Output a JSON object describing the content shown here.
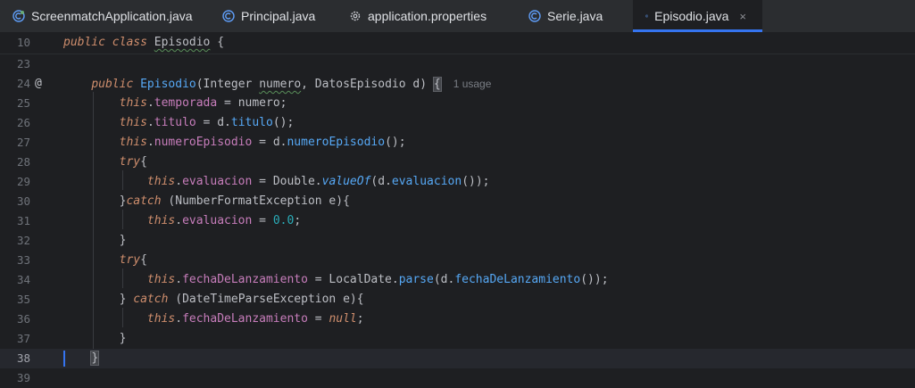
{
  "tabs": [
    {
      "label": "ScreenmatchApplication.java",
      "icon": "spring-class-icon",
      "active": false
    },
    {
      "label": "Principal.java",
      "icon": "class-icon",
      "active": false
    },
    {
      "label": "application.properties",
      "icon": "gear-icon",
      "active": false
    },
    {
      "label": "Serie.java",
      "icon": "class-icon",
      "active": false
    },
    {
      "label": "Episodio.java",
      "icon": "class-icon",
      "active": true
    }
  ],
  "close_glyph": "×",
  "lines": [
    {
      "n": "10"
    },
    {
      "n": "23"
    },
    {
      "n": "24"
    },
    {
      "n": "25"
    },
    {
      "n": "26"
    },
    {
      "n": "27"
    },
    {
      "n": "28"
    },
    {
      "n": "29"
    },
    {
      "n": "30"
    },
    {
      "n": "31"
    },
    {
      "n": "32"
    },
    {
      "n": "33"
    },
    {
      "n": "34"
    },
    {
      "n": "35"
    },
    {
      "n": "36"
    },
    {
      "n": "37"
    },
    {
      "n": "38"
    },
    {
      "n": "39"
    }
  ],
  "code": {
    "l10": {
      "kw1": "public",
      "kw2": "class",
      "name": "Episodio",
      "rest": " {"
    },
    "l24": {
      "kw": "public",
      "name": "Episodio",
      "p1": "(Integer ",
      "p2": "numero",
      "p3": ", DatosEpisodio d) ",
      "brace": "{",
      "hint": "1 usage"
    },
    "l25": {
      "this": "this",
      "field": "temporada",
      "rest": " = numero;"
    },
    "l26": {
      "this": "this",
      "field": "titulo",
      "mid": " = d.",
      "meth": "titulo",
      "rest": "();"
    },
    "l27": {
      "this": "this",
      "field": "numeroEpisodio",
      "mid": " = d.",
      "meth": "numeroEpisodio",
      "rest": "();"
    },
    "l28": {
      "kw": "try",
      "rest": "{"
    },
    "l29": {
      "this": "this",
      "field": "evaluacion",
      "mid": " = Double.",
      "meth": "valueOf",
      "mid2": "(d.",
      "meth2": "evaluacion",
      "rest": "());"
    },
    "l30": {
      "pre": "}",
      "kw": "catch",
      "rest": " (NumberFormatException e){"
    },
    "l31": {
      "this": "this",
      "field": "evaluacion",
      "mid": " = ",
      "num": "0.0",
      "rest": ";"
    },
    "l32": {
      "rest": "}"
    },
    "l33": {
      "kw": "try",
      "rest": "{"
    },
    "l34": {
      "this": "this",
      "field": "fechaDeLanzamiento",
      "mid": " = LocalDate.",
      "meth": "parse",
      "mid2": "(d.",
      "meth2": "fechaDeLanzamiento",
      "rest": "());"
    },
    "l35": {
      "pre": "} ",
      "kw": "catch",
      "rest": " (DateTimeParseException e){"
    },
    "l36": {
      "this": "this",
      "field": "fechaDeLanzamiento",
      "mid": " = ",
      "kwnull": "null",
      "rest": ";"
    },
    "l37": {
      "rest": "}"
    },
    "l38": {
      "rest": "}"
    }
  },
  "gutter_marker": "@"
}
